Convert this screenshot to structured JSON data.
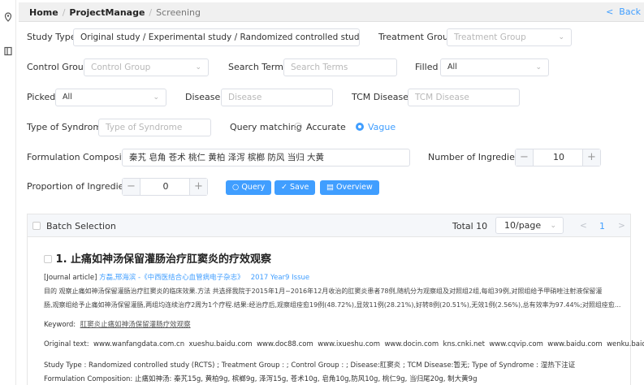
{
  "breadcrumb": {
    "home": "Home",
    "project": "ProjectManage",
    "current": "Screening",
    "back": "Back",
    "back_glyph": "<"
  },
  "filters": {
    "study_type": {
      "label": "Study Type",
      "value": "Original study / Experimental study / Randomized controlled study (RC..."
    },
    "treatment_group": {
      "label": "Treatment Group",
      "placeholder": "Treatment Group"
    },
    "control_group": {
      "label": "Control Group",
      "placeholder": "Control Group"
    },
    "search_terms": {
      "label": "Search Terms",
      "placeholder": "Search Terms"
    },
    "filled": {
      "label": "Filled",
      "value": "All"
    },
    "picked": {
      "label": "Picked",
      "value": "All"
    },
    "disease": {
      "label": "Disease",
      "placeholder": "Disease"
    },
    "tcm_disease": {
      "label": "TCM Disease",
      "placeholder": "TCM Disease"
    },
    "type_of_syndrome": {
      "label": "Type of Syndrome",
      "placeholder": "Type of Syndrome"
    },
    "query_matching": {
      "label": "Query matching",
      "options": [
        "Accurate",
        "Vague"
      ],
      "selected": "Vague"
    },
    "formulation": {
      "label": "Formulation Composition",
      "value": "秦艽 皂角 苍术 桃仁 黄柏 泽泻 槟榔 防风 当归 大黄"
    },
    "num_ingredients": {
      "label": "Number of Ingredients",
      "value": "10",
      "minus": "−",
      "plus": "+"
    },
    "proportion": {
      "label": "Proportion of Ingredients",
      "value": "0",
      "minus": "−",
      "plus": "+"
    }
  },
  "buttons": {
    "query": "Query",
    "save": "Save",
    "overview": "Overview"
  },
  "results": {
    "batch_selection": "Batch Selection",
    "total": "Total 10",
    "page_size": "10/page",
    "page": "1",
    "prev_glyph": "<",
    "next_glyph": ">",
    "item": {
      "title": "1. 止痛如神汤保留灌肠治疗肛窦炎的疗效观察",
      "journal_prefix": "[Journal article]",
      "authors": "方磊,邢海滨 -《中西医结合心血管病电子杂志》",
      "issue": "2017 Year9 Issue",
      "abstract_line1": "目的 观察止痛如神汤保留灌肠治疗肛窦炎的临床效果.方法 共选择我院于2015年1月~2016年12月收治的肛窦炎患者78例,随机分为观察组及对照组2组,每组39例,对照组给予甲硝唑注射液保留灌",
      "abstract_line2": "肠,观察组给予止痛如神汤保留灌肠,两组均连续治疗2周为1个疗程.结果:经治疗后,观察组痊愈19例(48.72%),显效11例(28.21%),好转8例(20.51%),无效1例(2.56%),总有效率为97.44%;对照组痊愈...",
      "keyword_label": "Keyword:",
      "keyword": "肛窦炎止痛如神汤保留灌肠疗效观察",
      "original_label": "Original text:",
      "original_links": [
        "www.wanfangdata.com.cn",
        "xueshu.baidu.com",
        "www.doc88.com",
        "www.ixueshu.com",
        "www.docin.com",
        "kns.cnki.net",
        "www.cqvip.com",
        "www.baidu.com",
        "wenku.baidu.com"
      ],
      "meta_line": "Study Type :  Randomized controlled study (RCTS) ;  Treatment Group :  ;  Control Group :  ;  Disease:肛窦炎 ;  TCM Disease:暂无;  Type of Syndrome : 湿热下注证",
      "formulation_line": "Formulation Composition:  止痛如神汤: 秦艽15g, 黄柏9g, 槟榔9g, 泽泻15g, 苍术10g, 皂角10g,防风10g, 桃仁9g, 当归尾20g, 制大黄9g"
    }
  },
  "colors": {
    "accent": "#409eff",
    "border": "#dcdfe6",
    "placeholder": "#b8b8b8"
  }
}
